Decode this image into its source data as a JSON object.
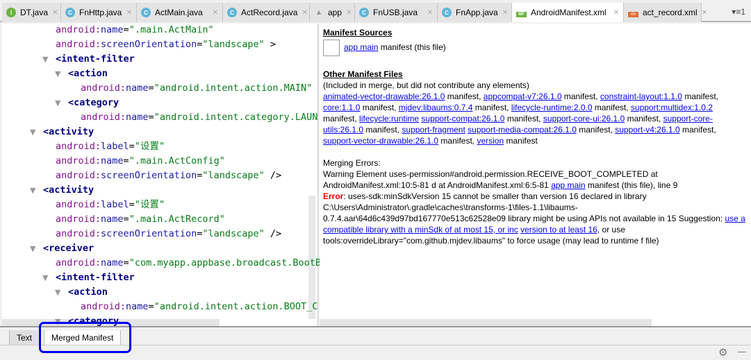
{
  "tabs": [
    {
      "label": "DT.java",
      "icon": "interface-icon",
      "kind": "i"
    },
    {
      "label": "FnHttp.java",
      "icon": "class-icon",
      "kind": "c"
    },
    {
      "label": "ActMain.java",
      "icon": "class-icon",
      "kind": "c"
    },
    {
      "label": "ActRecord.java",
      "icon": "class-icon",
      "kind": "c"
    },
    {
      "label": "app",
      "icon": "gradle-icon",
      "kind": "gr"
    },
    {
      "label": "FnUSB.java",
      "icon": "class-icon",
      "kind": "c"
    },
    {
      "label": "FnApp.java",
      "icon": "class-icon",
      "kind": "c"
    },
    {
      "label": "AndroidManifest.xml",
      "icon": "manifest-icon",
      "kind": "mf",
      "active": true
    },
    {
      "label": "act_record.xml",
      "icon": "xml-layout-icon",
      "kind": "xml"
    }
  ],
  "tab_overflow": "▾≡1",
  "code": [
    {
      "depth": 1,
      "ns": "android:",
      "attr": "name",
      "val": "\".main.ActMain\"",
      "tail": ""
    },
    {
      "depth": 1,
      "ns": "android:",
      "attr": "screenOrientation",
      "val": "\"landscape\"",
      "tail": " >"
    },
    {
      "depth": 1,
      "toggle": true,
      "tag": "<intent-filter"
    },
    {
      "depth": 2,
      "toggle": true,
      "tag": "<action"
    },
    {
      "depth": 3,
      "ns": "android:",
      "attr": "name",
      "val": "\"android.intent.action.MAIN\"",
      "tail": ""
    },
    {
      "depth": 2,
      "toggle": true,
      "tag": "<category"
    },
    {
      "depth": 3,
      "ns": "android:",
      "attr": "name",
      "val": "\"android.intent.category.LAUN",
      "tail": ""
    },
    {
      "depth": 0,
      "toggle": true,
      "tag": "<activity"
    },
    {
      "depth": 1,
      "ns": "android:",
      "attr": "label",
      "val": "\"设置\"",
      "tail": ""
    },
    {
      "depth": 1,
      "ns": "android:",
      "attr": "name",
      "val": "\".main.ActConfig\"",
      "tail": ""
    },
    {
      "depth": 1,
      "ns": "android:",
      "attr": "screenOrientation",
      "val": "\"landscape\"",
      "tail": " />"
    },
    {
      "depth": 0,
      "toggle": true,
      "tag": "<activity"
    },
    {
      "depth": 1,
      "ns": "android:",
      "attr": "label",
      "val": "\"设置\"",
      "tail": ""
    },
    {
      "depth": 1,
      "ns": "android:",
      "attr": "name",
      "val": "\".main.ActRecord\"",
      "tail": ""
    },
    {
      "depth": 1,
      "ns": "android:",
      "attr": "screenOrientation",
      "val": "\"landscape\"",
      "tail": " />"
    },
    {
      "depth": 0,
      "toggle": true,
      "tag": "<receiver"
    },
    {
      "depth": 1,
      "ns": "android:",
      "attr": "name",
      "val": "\"com.myapp.appbase.broadcast.BootB",
      "tail": ""
    },
    {
      "depth": 1,
      "toggle": true,
      "tag": "<intent-filter"
    },
    {
      "depth": 2,
      "toggle": true,
      "tag": "<action"
    },
    {
      "depth": 3,
      "ns": "android:",
      "attr": "name",
      "val": "\"android.intent.action.BOOT_C",
      "tail": ""
    },
    {
      "depth": 2,
      "toggle": true,
      "tag": "<category"
    }
  ],
  "manifest": {
    "sources_title": "Manifest Sources",
    "source_link": "app main",
    "source_suffix": " manifest (this file)",
    "other_title": "Other Manifest Files",
    "other_note": "(Included in merge, but did not contribute any elements)",
    "other_lines": [
      [
        {
          "l": "animated-vector-drawable:26.1.0"
        },
        {
          "t": " manifest, "
        },
        {
          "l": "appcompat-v7:26.1.0"
        },
        {
          "t": " manifest, "
        },
        {
          "l": "constraint-layout:1.1.0"
        },
        {
          "t": " manifest, "
        },
        {
          "l": "core:1.1.0"
        }
      ],
      [
        {
          "t": "manifest, "
        },
        {
          "l": "mjdev:libaums:0.7.4"
        },
        {
          "t": " manifest, "
        },
        {
          "l": "lifecycle-runtime:2.0.0"
        },
        {
          "t": " manifest, "
        },
        {
          "l": "support:multidex:1.0.2"
        },
        {
          "t": " manifest, "
        },
        {
          "l": "lifecycle:runtime"
        }
      ],
      [
        {
          "l": "support-compat:26.1.0"
        },
        {
          "t": " manifest, "
        },
        {
          "l": "support-core-ui:26.1.0"
        },
        {
          "t": " manifest, "
        },
        {
          "l": "support-core-utils:26.1.0"
        },
        {
          "t": " manifest, "
        },
        {
          "l": "support-fragment"
        }
      ],
      [
        {
          "l": "support-media-compat:26.1.0"
        },
        {
          "t": " manifest, "
        },
        {
          "l": "support-v4:26.1.0"
        },
        {
          "t": " manifest, "
        },
        {
          "l": "support-vector-drawable:26.1.0"
        },
        {
          "t": " manifest, "
        },
        {
          "l": "version"
        }
      ],
      [
        {
          "t": "manifest"
        }
      ]
    ],
    "errors_title": "Merging Errors:",
    "error_lines": [
      [
        {
          "t": "Warning Element uses-permission#android.permission.RECEIVE_BOOT_COMPLETED at AndroidManifest.xml:10:5-81 d"
        }
      ],
      [
        {
          "t": "at AndroidManifest.xml:6:5-81 "
        },
        {
          "l": "app main"
        },
        {
          "t": " manifest (this file), line 9"
        }
      ],
      [
        {
          "e": "Error"
        },
        {
          "t": ": uses-sdk:minSdkVersion 15 cannot be smaller than version 16 declared in library"
        }
      ],
      [
        {
          "t": "C:\\Users\\Administrator\\.gradle\\caches\\transforms-1\\files-1.1\\libaums-0.7.4.aar\\64d6c439d97bd167770e513c62528e09"
        }
      ],
      [
        {
          "t": "library might be using APIs not available in 15 Suggestion: "
        },
        {
          "l": "use a compatible library with a minSdk of at most 15, or inc"
        }
      ],
      [
        {
          "l": "version to at least 16,"
        },
        {
          "t": " or use tools:overrideLibrary=\"com.github.mjdev.libaums\" to force usage (may lead to runtime f"
        }
      ],
      [
        {
          "t": "file)"
        }
      ]
    ]
  },
  "bottom_tabs": {
    "text": "Text",
    "merged": "Merged Manifest"
  },
  "status": {
    "gear": "⚙",
    "minimize": "—"
  },
  "colors": {
    "link": "#0000ee",
    "error": "#e00000",
    "highlight": "#0000ee"
  }
}
